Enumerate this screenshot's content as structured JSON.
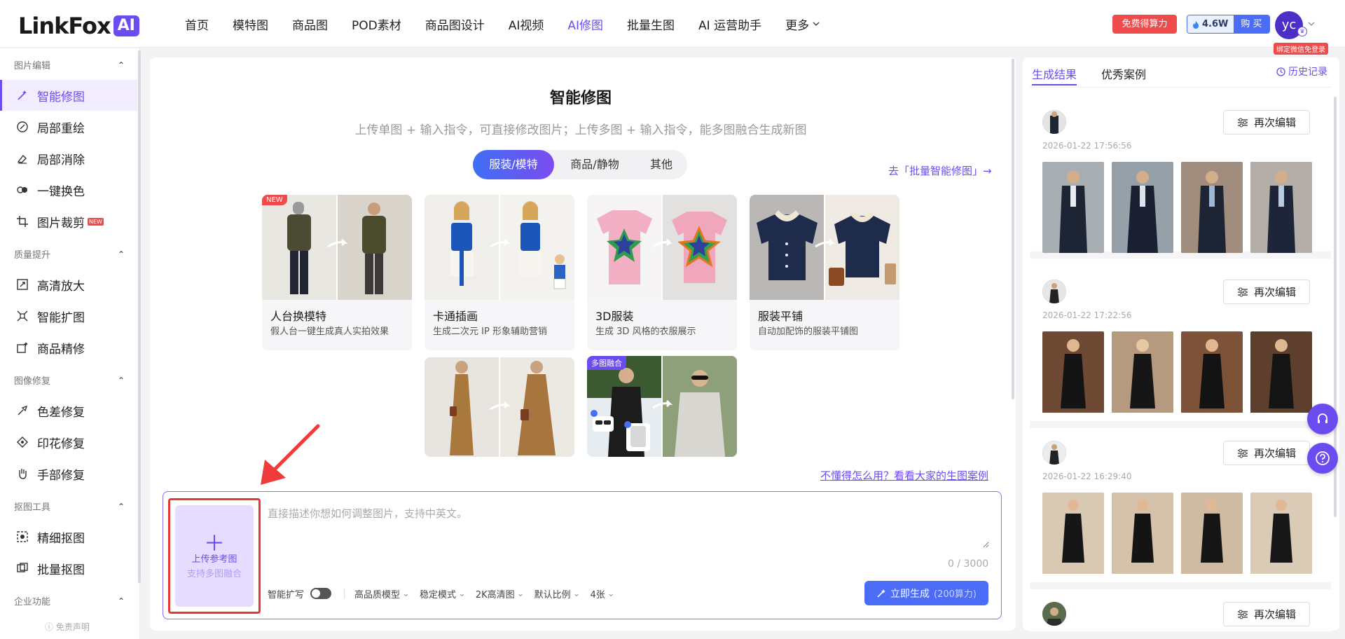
{
  "brand": {
    "logo_text": "LinkFox",
    "logo_ai": "AI"
  },
  "nav": {
    "items": [
      "首页",
      "模特图",
      "商品图",
      "POD素材",
      "商品图设计",
      "AI视频",
      "AI修图",
      "批量生图",
      "AI 运营助手"
    ],
    "active": "AI修图",
    "more": "更多"
  },
  "header": {
    "free_credit": "免费得算力",
    "credit_value": "4.6W",
    "buy": "购 买",
    "avatar_initials": "yc",
    "bind_tag": "绑定微信免登录"
  },
  "sidebar": {
    "groups": [
      {
        "title": "图片编辑",
        "items": [
          "智能修图",
          "局部重绘",
          "局部消除",
          "一键换色",
          "图片裁剪"
        ]
      },
      {
        "title": "质量提升",
        "items": [
          "高清放大",
          "智能扩图",
          "商品精修"
        ]
      },
      {
        "title": "图像修复",
        "items": [
          "色差修复",
          "印花修复",
          "手部修复"
        ]
      },
      {
        "title": "抠图工具",
        "items": [
          "精细抠图",
          "批量抠图"
        ]
      },
      {
        "title": "企业功能",
        "items": []
      }
    ],
    "active": "智能修图",
    "new_badge": "NEW",
    "disclaimer": "免责声明"
  },
  "main": {
    "title": "智能修图",
    "subtitle": "上传单图 + 输入指令，可直接修改图片；上传多图 + 输入指令，能多图融合生成新图",
    "tabs": [
      "服装/模特",
      "商品/静物",
      "其他"
    ],
    "active_tab": "服装/模特",
    "batch_link": "去「批量智能修图」→",
    "cards": [
      {
        "title": "人台换模特",
        "desc": "假人台一键生成真人实拍效果",
        "badge": "NEW"
      },
      {
        "title": "卡通插画",
        "desc": "生成二次元 IP 形象辅助营销",
        "badge": ""
      },
      {
        "title": "3D服装",
        "desc": "生成 3D 风格的衣服展示",
        "badge": ""
      },
      {
        "title": "服装平铺",
        "desc": "自动加配饰的服装平铺图",
        "badge": ""
      },
      {
        "title": "",
        "desc": "",
        "badge": ""
      },
      {
        "title": "",
        "desc": "",
        "badge": "多图融合"
      }
    ],
    "help_link": "不懂得怎么用？看看大家的生图案例",
    "upload": {
      "label": "上传参考图",
      "sub": "支持多图融合"
    },
    "prompt_placeholder": "直接描述你想如何调整图片，支持中英文。",
    "char_count": "0 / 3000",
    "options": {
      "expand": "智能扩写",
      "model": "高品质模型",
      "mode": "稳定模式",
      "resolution": "2K高清图",
      "ratio": "默认比例",
      "count": "4张"
    },
    "generate": {
      "label": "立即生成",
      "cost": "(200算力)"
    }
  },
  "results": {
    "tabs": [
      "生成结果",
      "优秀案例"
    ],
    "active_tab": "生成结果",
    "history": "历史记录",
    "edit_label": "再次编辑",
    "items": [
      {
        "time": "2026-01-22 17:56:56"
      },
      {
        "time": "2026-01-22 17:22:56"
      },
      {
        "time": "2026-01-22 16:29:40"
      },
      {
        "time": ""
      }
    ]
  },
  "colors": {
    "accent": "#6b4cf0",
    "primary_button": "#4a6cf7",
    "alert": "#f04b4b"
  }
}
